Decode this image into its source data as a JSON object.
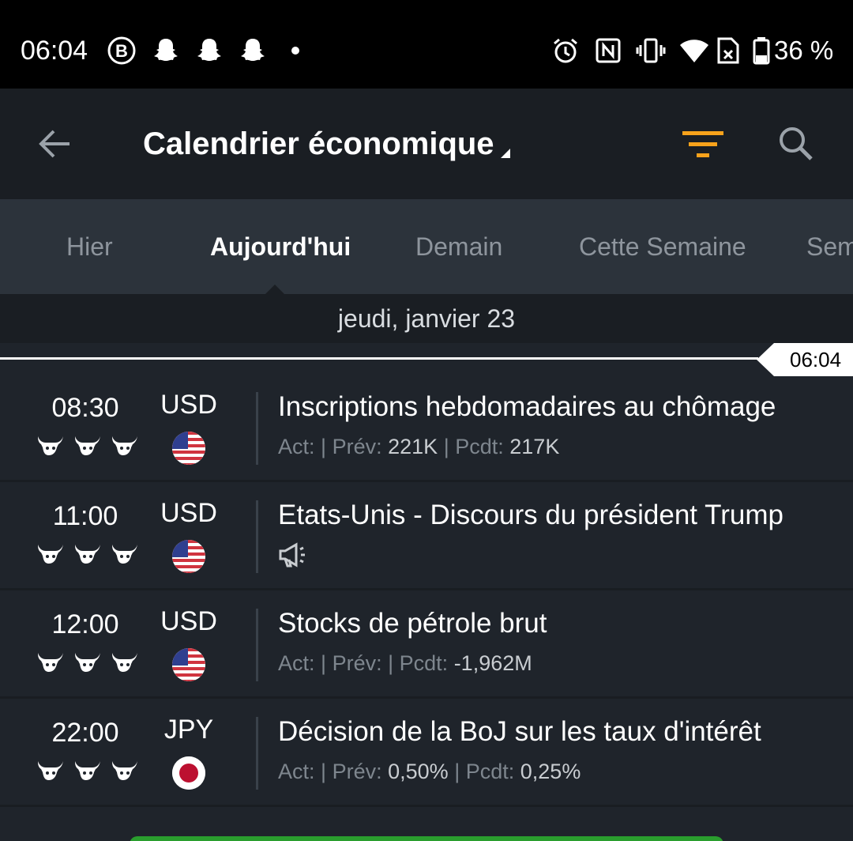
{
  "status_bar": {
    "time": "06:04",
    "battery_text": "36 %",
    "icons_left": [
      "b-icon",
      "snapchat-icon",
      "snapchat-icon",
      "snapchat-icon",
      "dot-icon"
    ],
    "icons_right": [
      "alarm-icon",
      "nfc-icon",
      "vibrate-icon",
      "wifi-icon",
      "sim-icon",
      "battery-icon"
    ]
  },
  "app_bar": {
    "title": "Calendrier économique",
    "icons": [
      "back-arrow-icon",
      "dropdown-caret-icon",
      "filter-icon",
      "search-icon"
    ],
    "filter_color": "#f7a21b"
  },
  "tabs": [
    {
      "label": "Hier",
      "active": false
    },
    {
      "label": "Aujourd'hui",
      "active": true
    },
    {
      "label": "Demain",
      "active": false
    },
    {
      "label": "Cette Semaine",
      "active": false
    },
    {
      "label": "Sem",
      "active": false
    }
  ],
  "date_header": "jeudi, janvier 23",
  "now_marker": "06:04",
  "detail_labels": {
    "actual": "Act:",
    "forecast": "Prév:",
    "previous": "Pcdt:",
    "sep": "|"
  },
  "events": [
    {
      "time": "08:30",
      "currency": "USD",
      "flag": "us-flag-icon",
      "importance": 3,
      "name": "Inscriptions hebdomadaires au chômage",
      "actual": "",
      "forecast": "221K",
      "previous": "217K",
      "speech": false
    },
    {
      "time": "11:00",
      "currency": "USD",
      "flag": "us-flag-icon",
      "importance": 3,
      "name": "Etats-Unis - Discours du président Trump",
      "speech": true
    },
    {
      "time": "12:00",
      "currency": "USD",
      "flag": "us-flag-icon",
      "importance": 3,
      "name": "Stocks de pétrole brut",
      "actual": "",
      "forecast": "",
      "previous": "-1,962M",
      "speech": false
    },
    {
      "time": "22:00",
      "currency": "JPY",
      "flag": "jp-flag-icon",
      "importance": 3,
      "name": "Décision de la BoJ sur les taux d'intérêt",
      "actual": "",
      "forecast": "0,50%",
      "previous": "0,25%",
      "speech": false
    }
  ],
  "colors": {
    "accent": "#f7a21b",
    "bottom_button": "#2a9e2e"
  }
}
